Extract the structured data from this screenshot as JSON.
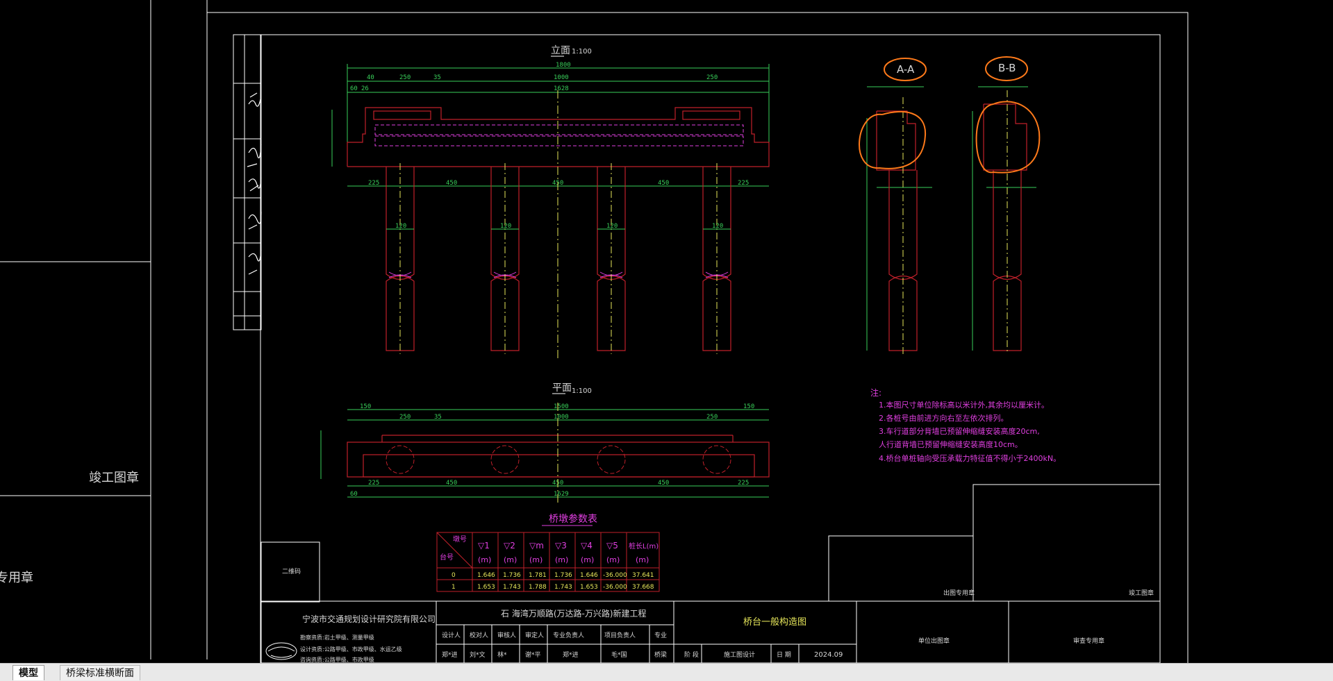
{
  "tabs": [
    {
      "label": "模型",
      "active": true
    },
    {
      "label": "桥梁标准横断面",
      "active": false
    }
  ],
  "side_panel": {
    "stamp_1": "竣工图章",
    "stamp_2": "专用章"
  },
  "drawing": {
    "elevation_title": "立面",
    "elevation_scale": "1:100",
    "plan_title": "平面",
    "plan_scale": "1:100",
    "section_a": "A-A",
    "section_b": "B-B",
    "dims_top": [
      "1800",
      "1000",
      "1628",
      "250",
      "250",
      "40",
      "35",
      "60",
      "26"
    ],
    "dims_spans": [
      "225",
      "450",
      "450",
      "450",
      "225"
    ],
    "pile_dim": "120",
    "plan_dims": [
      "150",
      "1500",
      "150",
      "250",
      "1000",
      "250",
      "1629",
      "60",
      "35"
    ],
    "notes_title": "注:",
    "notes": [
      "1.本图尺寸单位除标高以米计外,其余均以厘米计。",
      "2.各桩号由前进方向右至左依次排列。",
      "3.车行道部分背墙已预留伸缩缝安装高度20cm,",
      "   人行道背墙已预留伸缩缝安装高度10cm。",
      "4.桥台单桩轴向受压承载力特征值不得小于2400kN。"
    ],
    "table": {
      "title": "桥墩参数表",
      "diag_top": "墩号",
      "diag_bottom": "台号",
      "headers": [
        "▽1",
        "▽2",
        "▽m",
        "▽3",
        "▽4",
        "▽5",
        "桩长L(m)"
      ],
      "units": [
        "(m)",
        "(m)",
        "(m)",
        "(m)",
        "(m)",
        "(m)",
        "(m)"
      ],
      "rows": [
        [
          "0",
          "1.646",
          "1.736",
          "1.781",
          "1.736",
          "1.646",
          "-36.000",
          "37.641"
        ],
        [
          "1",
          "1.653",
          "1.743",
          "1.788",
          "1.743",
          "1.653",
          "-36.000",
          "37.668"
        ]
      ]
    },
    "qr_label": "二维码",
    "stamp_label_1": "出图专用章",
    "stamp_label_2": "竣工图章",
    "title_block": {
      "company": "宁波市交通规划设计研究院有限公司",
      "certs": [
        "勘察资质:岩土甲级、测量甲级",
        "设计资质:公路甲级、市政甲级、水运乙级",
        "咨询资质:公路甲级、市政甲级"
      ],
      "project": "石 海湾万顺路(万达路-万兴路)新建工程",
      "roles": [
        "设计人",
        "校对人",
        "审核人",
        "审定人",
        "专业负责人",
        "项目负责人",
        "专业"
      ],
      "names": [
        "郑*进",
        "刘*文",
        "林*",
        "谢*平",
        "郑*进",
        "毛*国",
        "桥梁"
      ],
      "drawing_name": "桥台一般构造图",
      "phase_label": "阶 段",
      "phase": "施工图设计",
      "date_label": "日 期",
      "date": "2024.09",
      "right_1": "单位出图章",
      "right_2": "审查专用章"
    }
  },
  "colors": {
    "frame": "#ffffff",
    "outline": "#c0202a",
    "dim": "#39d05a",
    "center": "#e6e65a",
    "magenta": "#e03fe0",
    "annotation": "#ff7a1a"
  }
}
